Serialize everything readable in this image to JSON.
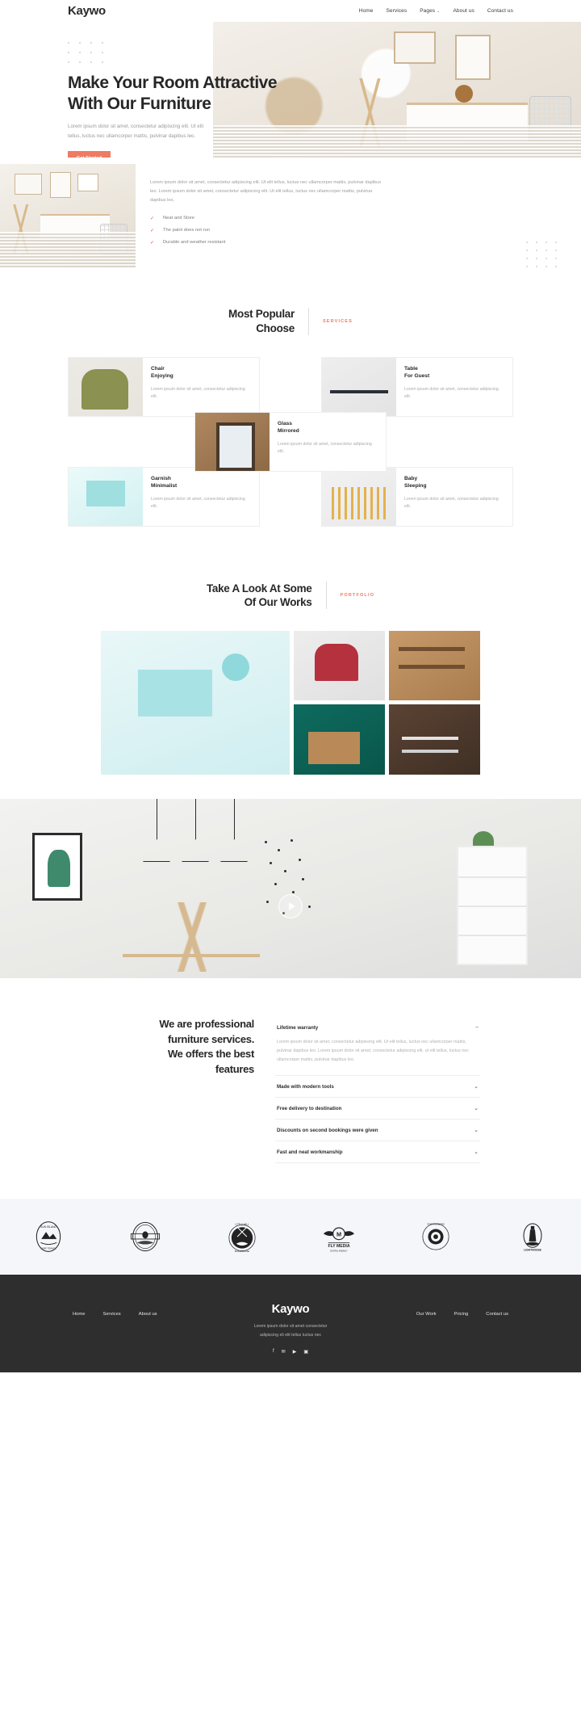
{
  "brand": "Kaywo",
  "nav": {
    "items": [
      {
        "label": "Home"
      },
      {
        "label": "Services"
      },
      {
        "label": "Pages",
        "caret": "⌄"
      },
      {
        "label": "About us"
      },
      {
        "label": "Contact us"
      }
    ]
  },
  "hero": {
    "title_line1": "Make Your Room Attractive",
    "title_line2": "With Our Furniture",
    "subtitle": "Lorem ipsum dolor sit amet, consectetur adipiscing elit. Ut elit tellus, luctus nec ullamcorper mattis, pulvinar dapibus leo.",
    "cta": "Get Started"
  },
  "about": {
    "paragraph": "Lorem ipsum dolor sit amet, consectetur adipiscing elit. Ut elit tellus, luctus nec ullamcorper mattis, pulvinar dapibus leo. Lorem ipsum dolor sit amet, consectetur adipiscing elit. Ut elit tellus, luctus nec ullamcorper mattis, pulvinar dapibus leo.",
    "checks": [
      {
        "icon": "check-icon",
        "label": "Neat and Store"
      },
      {
        "icon": "check-icon",
        "label": "The paint does not run"
      },
      {
        "icon": "check-icon",
        "label": "Durable and weather resistant"
      }
    ]
  },
  "services": {
    "heading_line1": "Most Popular",
    "heading_line2": "Choose",
    "tag": "SERVICES",
    "desc": "Lorem ipsum dolor sit amet, consectetur adipiscing elit.",
    "cards": [
      {
        "title_line1": "Chair",
        "title_line2": "Enjoying",
        "thumb": "chair-thumb"
      },
      {
        "title_line1": "Table",
        "title_line2": "For Guest",
        "thumb": "table-thumb"
      },
      {
        "title_line1": "Glass",
        "title_line2": "Mirrored",
        "thumb": "mirror-thumb"
      },
      {
        "title_line1": "Garnish",
        "title_line2": "Minimalist",
        "thumb": "garnish-thumb"
      },
      {
        "title_line1": "Baby",
        "title_line2": "Sleeping",
        "thumb": "baby-thumb"
      }
    ]
  },
  "portfolio": {
    "heading_line1": "Take A Look At Some",
    "heading_line2": "Of Our Works",
    "tag": "PORTFOLIO"
  },
  "video": {
    "play_label": "play-button"
  },
  "faq": {
    "title_line1": "We are professional",
    "title_line2": "furniture services.",
    "title_line3": "We offers the best",
    "title_line4": "features",
    "items": [
      {
        "question": "Lifetime warranty",
        "icon": "minus-icon",
        "open": true,
        "answer": "Lorem ipsum dolor sit amet, consectetur adipiscing elit. Ut elit tellus, luctus nec ullamcorper mattis, pulvinar dapibus leo. Lorem ipsum dolor sit amet, consectetur adipiscing elit. ut elit tellus, luctus nec ullamcorper mattis, pulvinar dapibus leo."
      },
      {
        "question": "Made with modern tools",
        "icon": "chevron-down-icon",
        "open": false,
        "answer": ""
      },
      {
        "question": "Free delivery to destination",
        "icon": "chevron-down-icon",
        "open": false,
        "answer": ""
      },
      {
        "question": "Discounts on second bookings were given",
        "icon": "chevron-down-icon",
        "open": false,
        "answer": ""
      },
      {
        "question": "Fast and neat workmanship",
        "icon": "chevron-down-icon",
        "open": false,
        "answer": ""
      }
    ]
  },
  "logos": [
    {
      "name": "sun-island-surf-travel-logo",
      "caption": "SUN ISLAND"
    },
    {
      "name": "badge-crest-logo",
      "caption": ""
    },
    {
      "name": "little-mill-bakehouse-logo",
      "caption": ""
    },
    {
      "name": "fly-media-logo",
      "caption": "FLY MEDIA",
      "sub": "DIGITAL AGENCY"
    },
    {
      "name": "star-flowers-logo",
      "caption": ""
    },
    {
      "name": "lighthouse-logo",
      "caption": "LIGHTHOUSE"
    }
  ],
  "footer": {
    "brand": "Kaywo",
    "tagline_line1": "Lorem ipsum dolor sit amet consectetur",
    "tagline_line2": "adipiscing eli elit tellus luctus nec",
    "left_links": [
      {
        "label": "Home"
      },
      {
        "label": "Services"
      },
      {
        "label": "About us"
      }
    ],
    "right_links": [
      {
        "label": "Our Work"
      },
      {
        "label": "Pricing"
      },
      {
        "label": "Contact us"
      }
    ],
    "social": [
      {
        "name": "facebook-icon",
        "glyph": "f"
      },
      {
        "name": "twitter-icon",
        "glyph": "✉"
      },
      {
        "name": "youtube-icon",
        "glyph": "▶"
      },
      {
        "name": "instagram-icon",
        "glyph": "▣"
      }
    ]
  },
  "colors": {
    "accent": "#ef7b62",
    "check": "#ef4f3e",
    "dark": "#2e2e2e",
    "logo_band": "#f5f6fa"
  }
}
